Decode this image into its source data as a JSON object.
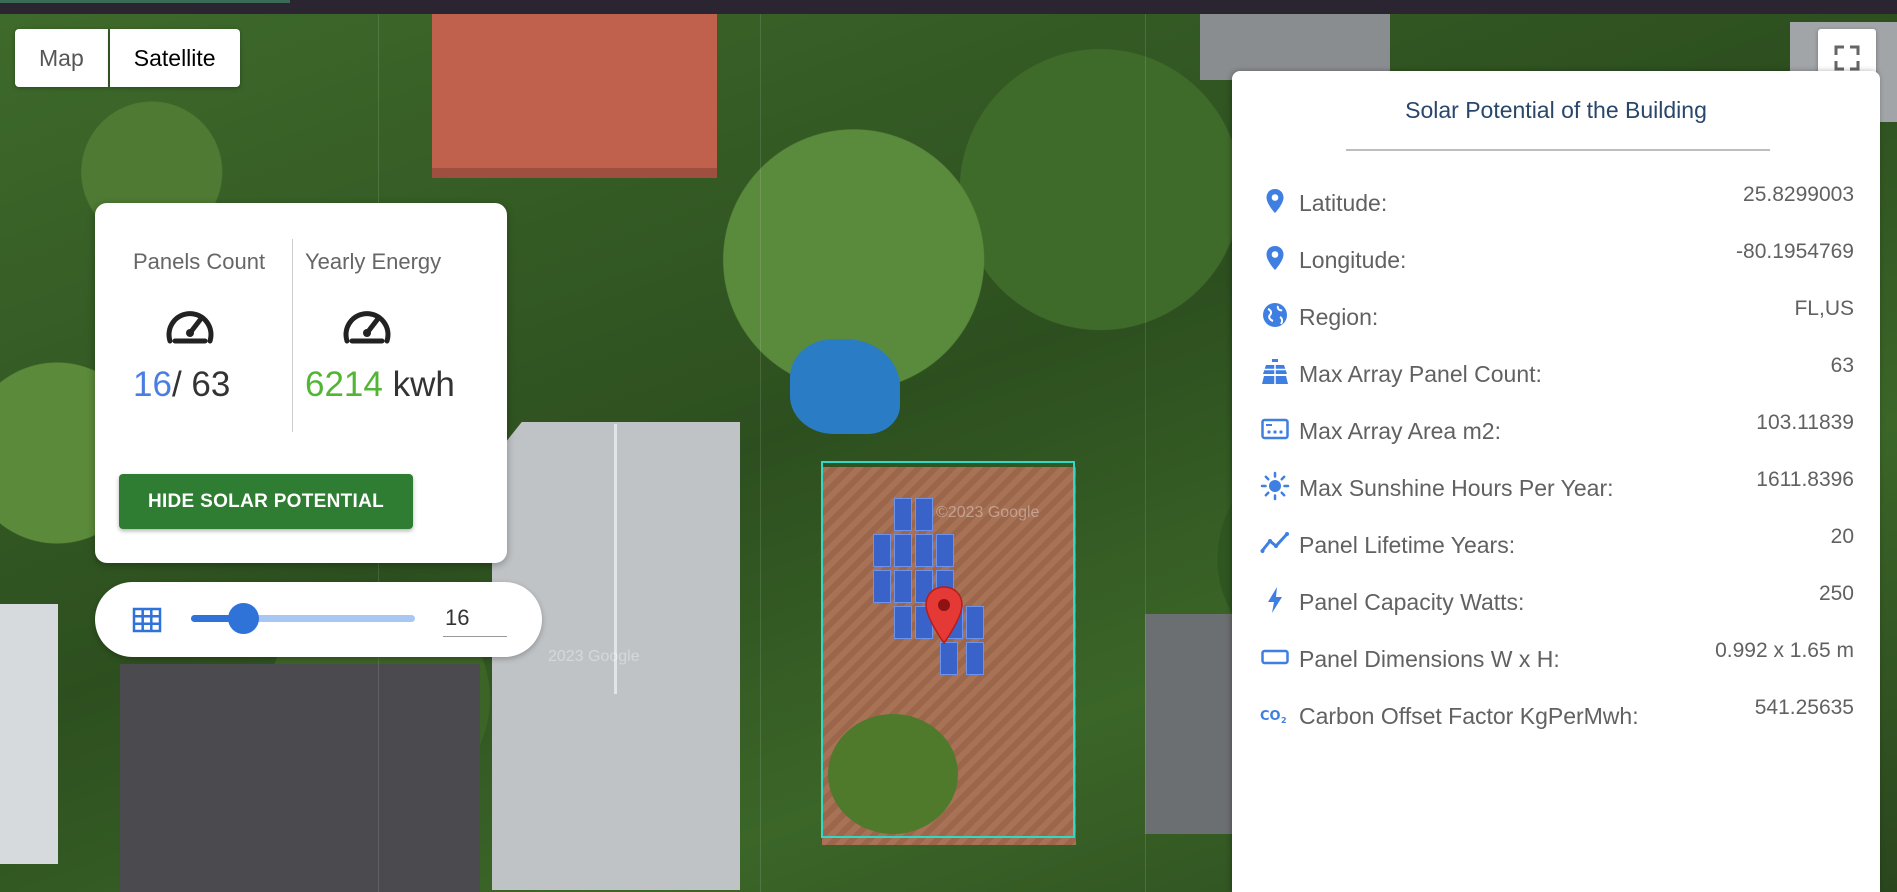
{
  "map_type_control": {
    "map_label": "Map",
    "satellite_label": "Satellite",
    "selected": "Satellite"
  },
  "fullscreen": {
    "icon": "fullscreen-icon"
  },
  "stats_card": {
    "panels": {
      "label": "Panels Count",
      "icon": "gauge-icon",
      "current": "16",
      "separator_and_max": "/ 63"
    },
    "energy": {
      "label": "Yearly Energy",
      "icon": "gauge-icon",
      "value": "6214",
      "unit": " kwh"
    },
    "hide_button_label": "HIDE SOLAR POTENTIAL"
  },
  "panel_slider": {
    "icon": "grid-icon",
    "value": "16",
    "min": 0,
    "max": 63,
    "fill_fraction": 0.23
  },
  "info_panel": {
    "title": "Solar Potential of the Building",
    "rows": [
      {
        "icon": "location-pin-icon",
        "label": "Latitude:",
        "value": "25.8299003"
      },
      {
        "icon": "location-pin-icon",
        "label": "Longitude:",
        "value": "-80.1954769"
      },
      {
        "icon": "globe-icon",
        "label": "Region:",
        "value": "FL,US"
      },
      {
        "icon": "solar-panel-icon",
        "label": "Max Array Panel Count:",
        "value": "63"
      },
      {
        "icon": "area-icon",
        "label": "Max Array Area m2:",
        "value": "103.11839"
      },
      {
        "icon": "sun-icon",
        "label": "Max Sunshine Hours Per Year:",
        "value": "1611.8396"
      },
      {
        "icon": "trend-icon",
        "label": "Panel Lifetime Years:",
        "value": "20"
      },
      {
        "icon": "bolt-icon",
        "label": "Panel Capacity Watts:",
        "value": "250"
      },
      {
        "icon": "rectangle-icon",
        "label": "Panel Dimensions W x H:",
        "value": "0.992 x 1.65 m"
      },
      {
        "icon": "co2-icon",
        "label": "Carbon Offset Factor KgPerMwh:",
        "value": "541.25635"
      }
    ]
  },
  "map": {
    "watermarks": [
      "©2023 Google",
      "2023 Google"
    ]
  },
  "colors": {
    "accent_blue": "#4a7ee0",
    "energy_green": "#52b634",
    "button_green": "#2e7d32",
    "selection_box": "#34d6c8",
    "panel_blue": "#3a63c9",
    "marker_red": "#e53935",
    "icon_blue": "#3f7fe2"
  }
}
